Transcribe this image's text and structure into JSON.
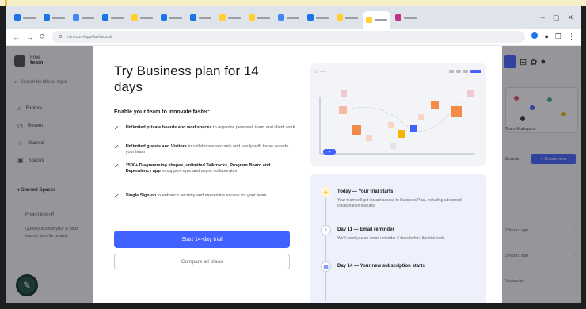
{
  "browser": {
    "tabs": [
      {
        "fav": "#1a73e8"
      },
      {
        "fav": "#1a73e8"
      },
      {
        "fav": "#4285f4"
      },
      {
        "fav": "#1a73e8"
      },
      {
        "fav": "#ffd02f"
      },
      {
        "fav": "#1a73e8"
      },
      {
        "fav": "#1a73e8"
      },
      {
        "fav": "#ffd02f"
      },
      {
        "fav": "#ffd02f"
      },
      {
        "fav": "#4285f4"
      },
      {
        "fav": "#1a73e8"
      },
      {
        "fav": "#ffd02f"
      },
      {
        "fav": "#ffd02f",
        "active": true
      },
      {
        "fav": "#c0308c"
      }
    ],
    "url": "miro.com/app/dashboard/"
  },
  "sidebar": {
    "team_plan": "Free",
    "team_name": "team",
    "search_placeholder": "Search by title or topic",
    "items": [
      {
        "icon": "home-icon",
        "label": "Explore"
      },
      {
        "icon": "clock-icon",
        "label": "Recent"
      },
      {
        "icon": "star-icon",
        "label": "Starred"
      },
      {
        "icon": "template-icon",
        "label": "Spaces"
      }
    ],
    "section": "Starred Spaces",
    "sub_items": [
      "Project kick-off",
      "Quickly access your & your",
      "team's favorite boards"
    ]
  },
  "rightpane": {
    "thumb_label": "Team Workspace",
    "list_label": "Boards",
    "create_label": "+ Create new",
    "rows": [
      "2 hours ago",
      "3 hours ago",
      "Yesterday"
    ]
  },
  "modal": {
    "title": "Try Business plan for 14 days",
    "subtitle": "Enable your team to innovate faster:",
    "features": [
      {
        "bold": "Unlimited private boards and workspaces",
        "rest": " to organize personal, team and client work"
      },
      {
        "bold": "Unlimited guests and Visitors",
        "rest": " to collaborate securely and easily with those outside your team"
      },
      {
        "bold": "2500+ Diagramming shapes, unlimited Talktracks, Program Board and Dependency app",
        "rest": " to support sync and async collaboration"
      },
      {
        "bold": "Single Sign-on",
        "rest": " to enhance security and streamline access for your team"
      }
    ],
    "cta": "Start 14-day trial",
    "secondary": "Compare all plans"
  },
  "timeline": [
    {
      "icon": "sun-icon",
      "color": "#f5b400",
      "head": "Today — Your trial starts",
      "desc": "Your team will get instant access to Business Plan, including advanced collaboration features"
    },
    {
      "icon": "bell-icon",
      "color": "#4262ff",
      "head": "Day 11 — Email reminder",
      "desc": "We'll send you an email reminder 3 days before the trial ends"
    },
    {
      "icon": "calendar-icon",
      "color": "#4262ff",
      "head": "Day 14 — Your new subscription starts",
      "desc": ""
    }
  ]
}
